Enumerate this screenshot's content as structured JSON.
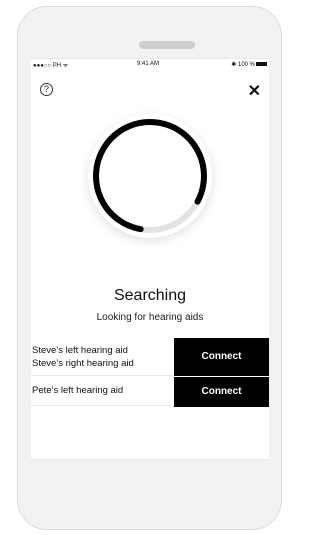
{
  "status_bar": {
    "carrier": "●●●○○ PH ᯤ",
    "time": "9:41 AM",
    "battery": "✱ 100 %"
  },
  "icons": {
    "help": "?",
    "close": "✕"
  },
  "search": {
    "title": "Searching",
    "subtitle": "Looking for hearing aids",
    "progress": 0.8
  },
  "devices": [
    {
      "names": [
        "Steve’s left hearing aid",
        "Steve’s right hearing aid"
      ],
      "action": "Connect"
    },
    {
      "names": [
        "Pete’s left hearing aid"
      ],
      "action": "Connect"
    }
  ],
  "colors": {
    "accent": "#000000",
    "background": "#f2f2f2"
  }
}
